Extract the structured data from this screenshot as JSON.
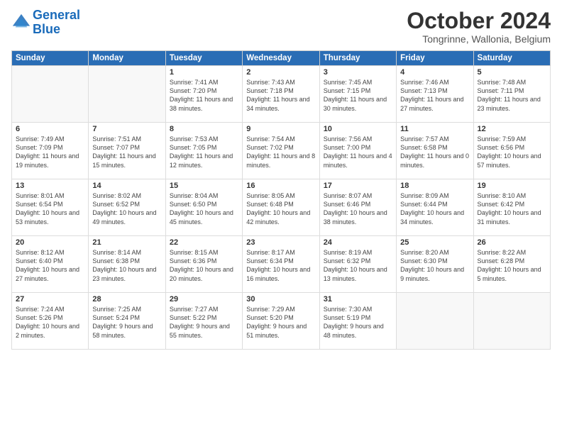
{
  "header": {
    "logo_line1": "General",
    "logo_line2": "Blue",
    "title": "October 2024",
    "location": "Tongrinne, Wallonia, Belgium"
  },
  "days_of_week": [
    "Sunday",
    "Monday",
    "Tuesday",
    "Wednesday",
    "Thursday",
    "Friday",
    "Saturday"
  ],
  "weeks": [
    [
      {
        "day": "",
        "info": ""
      },
      {
        "day": "",
        "info": ""
      },
      {
        "day": "1",
        "info": "Sunrise: 7:41 AM\nSunset: 7:20 PM\nDaylight: 11 hours and 38 minutes."
      },
      {
        "day": "2",
        "info": "Sunrise: 7:43 AM\nSunset: 7:18 PM\nDaylight: 11 hours and 34 minutes."
      },
      {
        "day": "3",
        "info": "Sunrise: 7:45 AM\nSunset: 7:15 PM\nDaylight: 11 hours and 30 minutes."
      },
      {
        "day": "4",
        "info": "Sunrise: 7:46 AM\nSunset: 7:13 PM\nDaylight: 11 hours and 27 minutes."
      },
      {
        "day": "5",
        "info": "Sunrise: 7:48 AM\nSunset: 7:11 PM\nDaylight: 11 hours and 23 minutes."
      }
    ],
    [
      {
        "day": "6",
        "info": "Sunrise: 7:49 AM\nSunset: 7:09 PM\nDaylight: 11 hours and 19 minutes."
      },
      {
        "day": "7",
        "info": "Sunrise: 7:51 AM\nSunset: 7:07 PM\nDaylight: 11 hours and 15 minutes."
      },
      {
        "day": "8",
        "info": "Sunrise: 7:53 AM\nSunset: 7:05 PM\nDaylight: 11 hours and 12 minutes."
      },
      {
        "day": "9",
        "info": "Sunrise: 7:54 AM\nSunset: 7:02 PM\nDaylight: 11 hours and 8 minutes."
      },
      {
        "day": "10",
        "info": "Sunrise: 7:56 AM\nSunset: 7:00 PM\nDaylight: 11 hours and 4 minutes."
      },
      {
        "day": "11",
        "info": "Sunrise: 7:57 AM\nSunset: 6:58 PM\nDaylight: 11 hours and 0 minutes."
      },
      {
        "day": "12",
        "info": "Sunrise: 7:59 AM\nSunset: 6:56 PM\nDaylight: 10 hours and 57 minutes."
      }
    ],
    [
      {
        "day": "13",
        "info": "Sunrise: 8:01 AM\nSunset: 6:54 PM\nDaylight: 10 hours and 53 minutes."
      },
      {
        "day": "14",
        "info": "Sunrise: 8:02 AM\nSunset: 6:52 PM\nDaylight: 10 hours and 49 minutes."
      },
      {
        "day": "15",
        "info": "Sunrise: 8:04 AM\nSunset: 6:50 PM\nDaylight: 10 hours and 45 minutes."
      },
      {
        "day": "16",
        "info": "Sunrise: 8:05 AM\nSunset: 6:48 PM\nDaylight: 10 hours and 42 minutes."
      },
      {
        "day": "17",
        "info": "Sunrise: 8:07 AM\nSunset: 6:46 PM\nDaylight: 10 hours and 38 minutes."
      },
      {
        "day": "18",
        "info": "Sunrise: 8:09 AM\nSunset: 6:44 PM\nDaylight: 10 hours and 34 minutes."
      },
      {
        "day": "19",
        "info": "Sunrise: 8:10 AM\nSunset: 6:42 PM\nDaylight: 10 hours and 31 minutes."
      }
    ],
    [
      {
        "day": "20",
        "info": "Sunrise: 8:12 AM\nSunset: 6:40 PM\nDaylight: 10 hours and 27 minutes."
      },
      {
        "day": "21",
        "info": "Sunrise: 8:14 AM\nSunset: 6:38 PM\nDaylight: 10 hours and 23 minutes."
      },
      {
        "day": "22",
        "info": "Sunrise: 8:15 AM\nSunset: 6:36 PM\nDaylight: 10 hours and 20 minutes."
      },
      {
        "day": "23",
        "info": "Sunrise: 8:17 AM\nSunset: 6:34 PM\nDaylight: 10 hours and 16 minutes."
      },
      {
        "day": "24",
        "info": "Sunrise: 8:19 AM\nSunset: 6:32 PM\nDaylight: 10 hours and 13 minutes."
      },
      {
        "day": "25",
        "info": "Sunrise: 8:20 AM\nSunset: 6:30 PM\nDaylight: 10 hours and 9 minutes."
      },
      {
        "day": "26",
        "info": "Sunrise: 8:22 AM\nSunset: 6:28 PM\nDaylight: 10 hours and 5 minutes."
      }
    ],
    [
      {
        "day": "27",
        "info": "Sunrise: 7:24 AM\nSunset: 5:26 PM\nDaylight: 10 hours and 2 minutes."
      },
      {
        "day": "28",
        "info": "Sunrise: 7:25 AM\nSunset: 5:24 PM\nDaylight: 9 hours and 58 minutes."
      },
      {
        "day": "29",
        "info": "Sunrise: 7:27 AM\nSunset: 5:22 PM\nDaylight: 9 hours and 55 minutes."
      },
      {
        "day": "30",
        "info": "Sunrise: 7:29 AM\nSunset: 5:20 PM\nDaylight: 9 hours and 51 minutes."
      },
      {
        "day": "31",
        "info": "Sunrise: 7:30 AM\nSunset: 5:19 PM\nDaylight: 9 hours and 48 minutes."
      },
      {
        "day": "",
        "info": ""
      },
      {
        "day": "",
        "info": ""
      }
    ]
  ]
}
